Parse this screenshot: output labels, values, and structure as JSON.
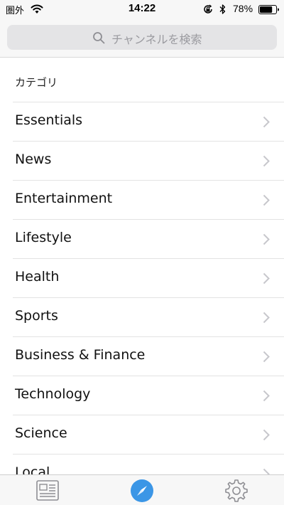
{
  "status_bar": {
    "carrier": "圏外",
    "time": "14:22",
    "battery_percent": "78%",
    "battery_level": 0.78
  },
  "search": {
    "placeholder": "チャンネルを検索"
  },
  "section": {
    "title": "カテゴリ"
  },
  "categories": [
    {
      "label": "Essentials"
    },
    {
      "label": "News"
    },
    {
      "label": "Entertainment"
    },
    {
      "label": "Lifestyle"
    },
    {
      "label": "Health"
    },
    {
      "label": "Sports"
    },
    {
      "label": "Business & Finance"
    },
    {
      "label": "Technology"
    },
    {
      "label": "Science"
    },
    {
      "label": "Local"
    }
  ],
  "tab_bar": {
    "tabs": [
      {
        "icon": "newspaper-icon",
        "selected": false
      },
      {
        "icon": "compass-icon",
        "selected": true
      },
      {
        "icon": "gear-icon",
        "selected": false
      }
    ]
  },
  "colors": {
    "accent": "#3b96e6",
    "inactive_icon": "#8e8e93",
    "chevron": "#c7c7cc"
  }
}
